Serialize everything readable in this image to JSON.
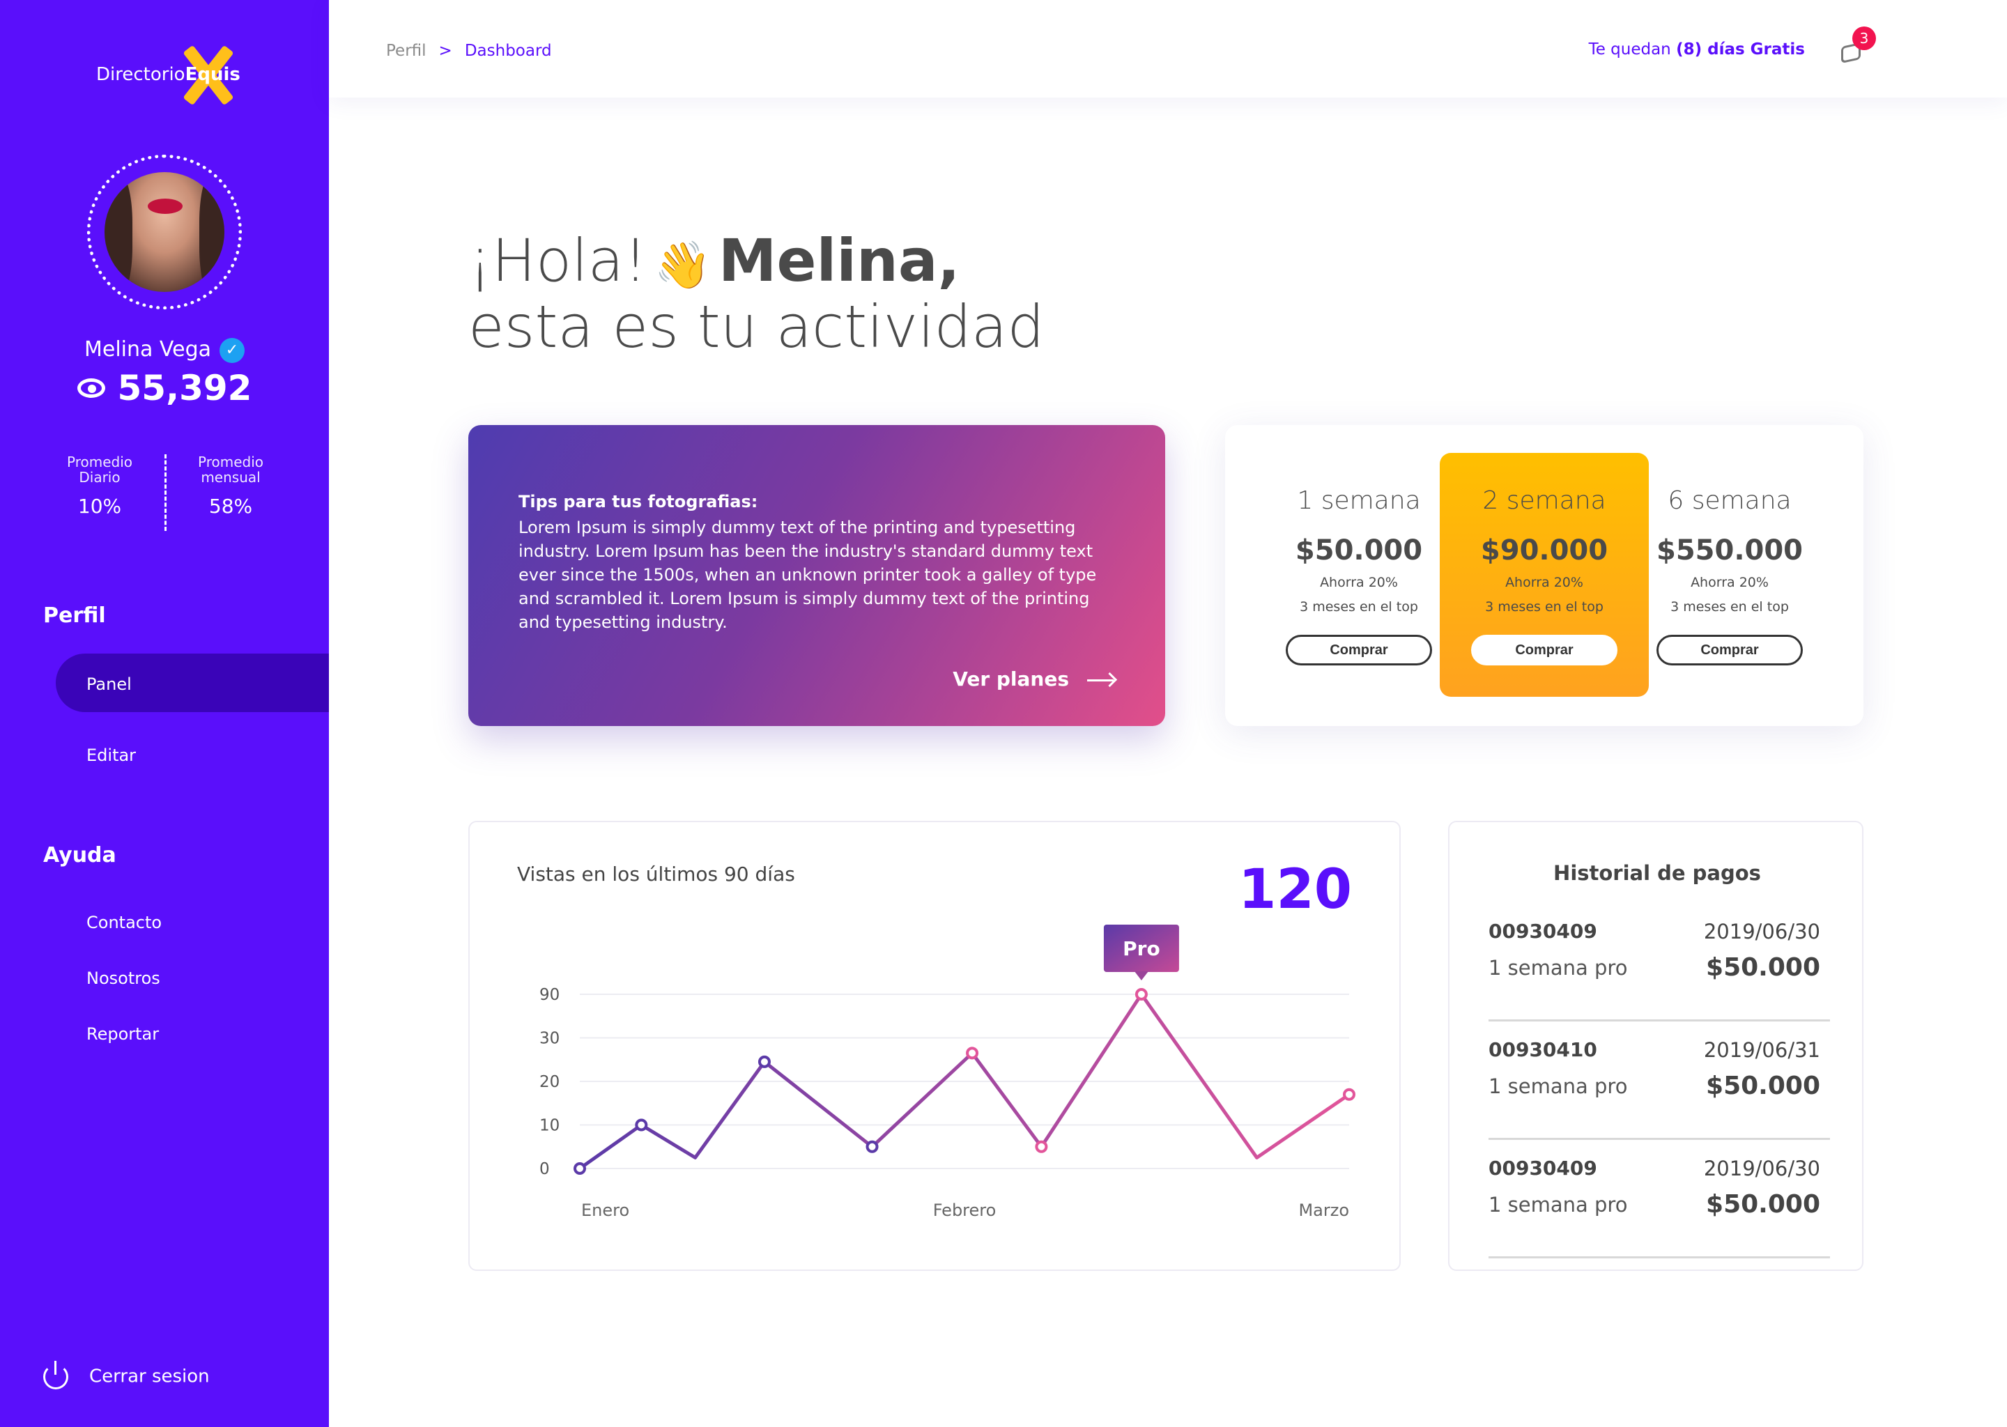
{
  "brand": {
    "part1": "Directorio",
    "part2": "Equis"
  },
  "user": {
    "name": "Melina Vega",
    "views": "55,392"
  },
  "stats": [
    {
      "label_line1": "Promedio",
      "label_line2": "Diario",
      "value": "10%"
    },
    {
      "label_line1": "Promedio",
      "label_line2": "mensual",
      "value": "58%"
    }
  ],
  "sidebar": {
    "section_profile": "Perfil",
    "profile_items": [
      "Panel",
      "Editar"
    ],
    "section_help": "Ayuda",
    "help_items": [
      "Contacto",
      "Nosotros",
      "Reportar"
    ],
    "logout": "Cerrar sesion"
  },
  "topbar": {
    "breadcrumb": [
      "Perfil",
      "Dashboard"
    ],
    "trial_prefix": "Te quedan",
    "trial_bold": "(8) días Gratis",
    "notifications": "3"
  },
  "greeting": {
    "line1_prefix": "¡Hola!",
    "wave": "👋",
    "name": "Melina,",
    "line2": "esta es tu actividad"
  },
  "tips": {
    "title": "Tips para tus fotografias:",
    "body": "Lorem Ipsum is simply dummy text of the printing and typesetting industry. Lorem Ipsum has been the industry's standard dummy text ever since the 1500s, when an unknown printer took a galley of type and scrambled it. Lorem Ipsum is simply dummy text of the printing and typesetting industry.",
    "link": "Ver planes"
  },
  "plans": [
    {
      "name": "1 semana",
      "price": "$50.000",
      "save": "Ahorra 20%",
      "detail": "3 meses en el top",
      "button": "Comprar",
      "featured": false
    },
    {
      "name": "2 semana",
      "price": "$90.000",
      "save": "Ahorra 20%",
      "detail": "3 meses en el top",
      "button": "Comprar",
      "featured": true
    },
    {
      "name": "6 semana",
      "price": "$550.000",
      "save": "Ahorra 20%",
      "detail": "3 meses en el top",
      "button": "Comprar",
      "featured": false
    }
  ],
  "views_chart": {
    "title": "Vistas en los últimos 90 días",
    "total": "120",
    "tooltip": "Pro"
  },
  "chart_data": {
    "type": "line",
    "title": "Vistas en los últimos 90 días",
    "y_tick_labels": [
      "0",
      "10",
      "20",
      "30",
      "90"
    ],
    "x_tick_labels": [
      "Enero",
      "Febrero",
      "Marzo"
    ],
    "note": "y axis is non-linear (ticks 0,10,20,30,90 equally spaced); values expressed in tick-position units",
    "points_tick_units": [
      0.0,
      1.0,
      0.25,
      2.45,
      0.5,
      2.65,
      0.5,
      4.0,
      0.25,
      1.7
    ],
    "x_fraction": [
      0.0,
      0.08,
      0.15,
      0.24,
      0.38,
      0.51,
      0.6,
      0.73,
      0.88,
      1.0
    ],
    "marker_indices": [
      0,
      1,
      3,
      4,
      5,
      6,
      7,
      9
    ],
    "peak_label_index": 7,
    "colors": {
      "start": "#5b3aa8",
      "end": "#e2559a",
      "marker_fill": "#ffffff"
    }
  },
  "payments": {
    "title": "Historial de pagos",
    "rows": [
      {
        "id": "00930409",
        "date": "2019/06/30",
        "desc": "1 semana pro",
        "amount": "$50.000"
      },
      {
        "id": "00930410",
        "date": "2019/06/31",
        "desc": "1 semana pro",
        "amount": "$50.000"
      },
      {
        "id": "00930409",
        "date": "2019/06/30",
        "desc": "1 semana pro",
        "amount": "$50.000"
      }
    ]
  },
  "colors": {
    "sidebar": "#5a0ffb",
    "accent": "#5a0ffb",
    "featured": "#ffb300",
    "badge": "#f2134f",
    "verified": "#1da1f2"
  }
}
